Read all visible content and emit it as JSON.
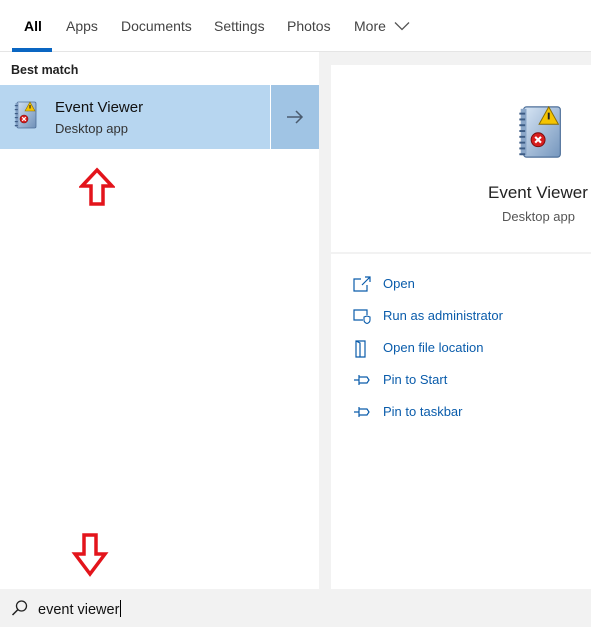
{
  "tabs": [
    {
      "label": "All",
      "active": true
    },
    {
      "label": "Apps",
      "active": false
    },
    {
      "label": "Documents",
      "active": false
    },
    {
      "label": "Settings",
      "active": false
    },
    {
      "label": "Photos",
      "active": false
    },
    {
      "label": "More",
      "active": false
    }
  ],
  "left_pane": {
    "section_heading": "Best match",
    "best_match": {
      "title": "Event Viewer",
      "subtitle": "Desktop app",
      "icon": "event-viewer-icon"
    }
  },
  "right_pane": {
    "app_title": "Event Viewer",
    "app_subtitle": "Desktop app",
    "actions": [
      {
        "label": "Open",
        "icon": "open-icon"
      },
      {
        "label": "Run as administrator",
        "icon": "run-as-admin-icon"
      },
      {
        "label": "Open file location",
        "icon": "file-location-icon"
      },
      {
        "label": "Pin to Start",
        "icon": "pin-icon"
      },
      {
        "label": "Pin to taskbar",
        "icon": "pin-icon"
      }
    ]
  },
  "search": {
    "query": "event viewer",
    "icon": "search-icon"
  },
  "colors": {
    "accent": "#0a66c2",
    "selected_result": "#b7d6f0",
    "selected_arrow": "#a0c4e4",
    "link": "#0a5cab",
    "annotation_arrow": "#e3141b"
  }
}
